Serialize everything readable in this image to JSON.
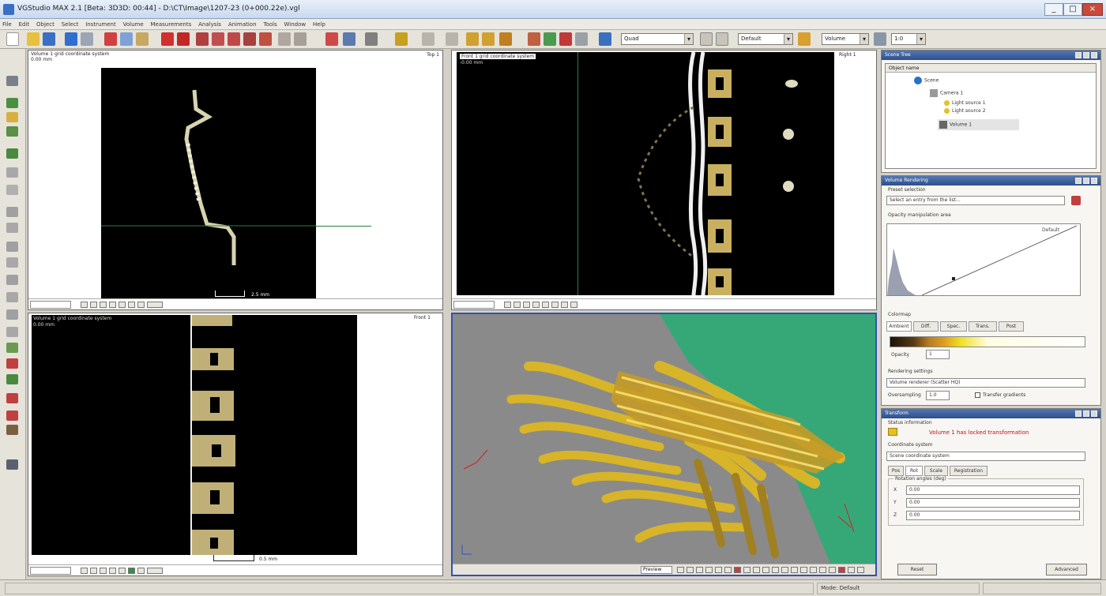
{
  "window": {
    "title": "VGStudio MAX 2.1 [Beta: 3D3D: 00:44] - D:\\CT\\Image\\1207-23 (0+000.22e).vgl",
    "buttons": {
      "minimize": "_",
      "maximize": "□",
      "close": "×"
    }
  },
  "menu": [
    "File",
    "Edit",
    "Object",
    "Select",
    "Instrument",
    "Volume",
    "Measurements",
    "Analysis",
    "Animation",
    "Tools",
    "Window",
    "Help"
  ],
  "toolbar": {
    "tool_select": "Quad",
    "view_select": "Default",
    "volume_select": "Volume",
    "zoom_select": "1:0"
  },
  "viewports": {
    "top_left": {
      "title": "Volume 1 grid coordinate system",
      "subtitle": "0.00 mm",
      "right": "Top 1",
      "scale": "2.5 mm"
    },
    "top_right": {
      "title": "Front 1 grid coordinate system",
      "subtitle": "-0.00 mm",
      "right": "Right 1"
    },
    "bottom_left": {
      "title": "Volume 1 grid coordinate system",
      "subtitle": "0.00 mm",
      "right": "Front 1",
      "scale": "0.5 mm"
    },
    "bottom_right": {
      "footer_select": "Preview"
    }
  },
  "scene_tree": {
    "title": "Scene Tree",
    "header": "Object name",
    "items": [
      "Scene",
      "Camera 1",
      "Light source 1",
      "Light source 2",
      "Volume 1"
    ]
  },
  "volume_rendering": {
    "title": "Volume Rendering",
    "preset_label": "Preset selection",
    "preset_value": "Select an entry from the list...",
    "opacity_label": "Opacity manipulation area",
    "hist_annotation": "Default",
    "colormap_label": "Colormap",
    "tabs": [
      "Ambient",
      "Diff.",
      "Spec.",
      "Trans.",
      "Post"
    ],
    "opacity_field_label": "Opacity",
    "opacity_value": "1",
    "rendering_settings_label": "Rendering settings",
    "renderer_value": "Volume renderer (Scatter HQ)",
    "oversampling_label": "Oversampling",
    "oversampling_value": "1.0",
    "gradient_label": "Transfer gradients"
  },
  "transform": {
    "title": "Transform",
    "status_label": "Status information",
    "status_message": "Volume 1 has locked transformation",
    "coord_label": "Coordinate system",
    "coord_value": "Scene coordinate system",
    "tabs": [
      "Pos",
      "Rot",
      "Scale",
      "Registration"
    ],
    "group_label": "Rotation angles (deg)",
    "rows": [
      {
        "axis": "X",
        "value": "0.00"
      },
      {
        "axis": "Y",
        "value": "0.00"
      },
      {
        "axis": "Z",
        "value": "0.00"
      }
    ],
    "buttons": {
      "reset": "Reset",
      "advanced": "Advanced"
    }
  },
  "statusbar": {
    "mode": "Mode: Default"
  },
  "colors": {
    "accent": "#2d4f8c",
    "gold": "#d4b020",
    "green_plane": "#36a878",
    "red_msg": "#c0101a"
  }
}
